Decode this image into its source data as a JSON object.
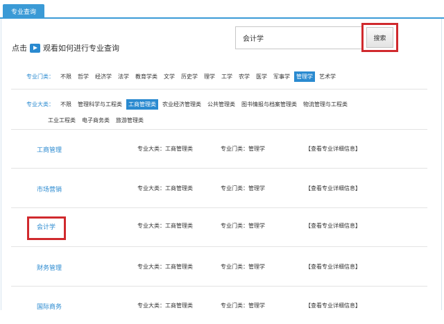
{
  "tab": {
    "label": "专业查询"
  },
  "watch": {
    "prefix": "点击",
    "text": "观看如何进行专业查询"
  },
  "search": {
    "value": "会计学",
    "button_label": "搜索"
  },
  "filters": {
    "door": {
      "label": "专业门类：",
      "options": [
        "不限",
        "哲学",
        "经济学",
        "法学",
        "教育学类",
        "文学",
        "历史学",
        "理学",
        "工学",
        "农学",
        "医学",
        "军事学",
        "管理学",
        "艺术学"
      ],
      "selected": "管理学"
    },
    "category": {
      "label": "专业大类：",
      "options": [
        "不限",
        "管理科学与工程类",
        "工商管理类",
        "农业经济管理类",
        "公共管理类",
        "图书情报与档案管理类",
        "物流管理与工程类",
        "工业工程类",
        "电子商务类",
        "旅游管理类"
      ],
      "selected": "工商管理类"
    }
  },
  "results": [
    {
      "name": "工商管理",
      "category": "专业大类：工商管理类",
      "door": "专业门类：管理学",
      "detail": "【查看专业详细信息】"
    },
    {
      "name": "市场营销",
      "category": "专业大类：工商管理类",
      "door": "专业门类：管理学",
      "detail": "【查看专业详细信息】"
    },
    {
      "name": "会计学",
      "category": "专业大类：工商管理类",
      "door": "专业门类：管理学",
      "detail": "【查看专业详细信息】"
    },
    {
      "name": "财务管理",
      "category": "专业大类：工商管理类",
      "door": "专业门类：管理学",
      "detail": "【查看专业详细信息】"
    },
    {
      "name": "国际商务",
      "category": "专业大类：工商管理类",
      "door": "专业门类：管理学",
      "detail": "【查看专业详细信息】"
    }
  ],
  "colors": {
    "accent": "#2a8ad0",
    "highlight": "#d0292d"
  }
}
